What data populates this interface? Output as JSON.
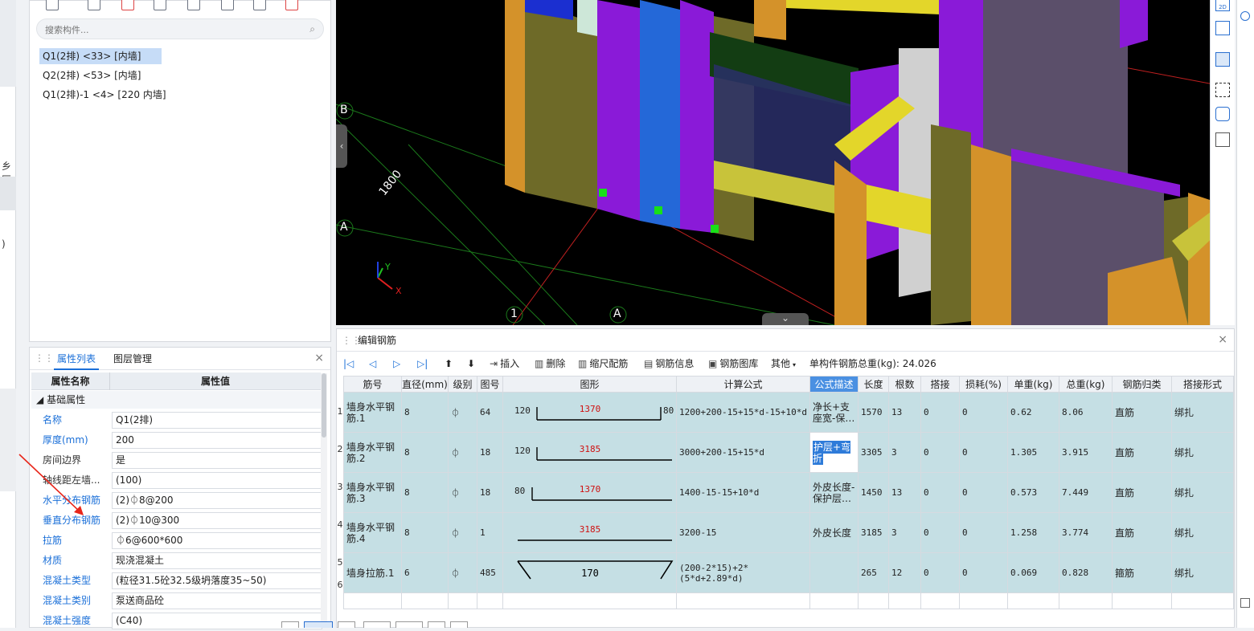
{
  "left_strip": {
    "text_1": "乡区.",
    "text_2": ")"
  },
  "components": {
    "search_placeholder": "搜索构件...",
    "items": [
      {
        "label": "Q1(2排) <33> [内墙]"
      },
      {
        "label": "Q2(2排) <53> [内墙]"
      },
      {
        "label": "Q1(2排)-1 <4> [220 内墙]"
      }
    ]
  },
  "properties": {
    "tabs": [
      "属性列表",
      "图层管理"
    ],
    "header_name": "属性名称",
    "header_value": "属性值",
    "group": "基础属性",
    "rows": [
      {
        "name": "名称",
        "value": "Q1(2排)"
      },
      {
        "name": "厚度(mm)",
        "value": "200"
      },
      {
        "name": "房间边界",
        "value": "是"
      },
      {
        "name": "轴线距左墙...",
        "value": "(100)"
      },
      {
        "name": "水平分布钢筋",
        "value": "(2)⏀8@200"
      },
      {
        "name": "垂直分布钢筋",
        "value": "(2)⏀10@300"
      },
      {
        "name": "拉筋",
        "value": "⏀6@600*600"
      },
      {
        "name": "材质",
        "value": "现浇混凝土"
      },
      {
        "name": "混凝土类型",
        "value": "(粒径31.5砼32.5级坍落度35~50)"
      },
      {
        "name": "混凝土类别",
        "value": "泵送商品砼"
      },
      {
        "name": "混凝土强度",
        "value": "(C40)"
      }
    ]
  },
  "viewport": {
    "axis_b": "B",
    "axis_a_left": "A",
    "axis_1": "1",
    "axis_a_bottom": "A",
    "dimension": "1800",
    "coord_x": "X",
    "coord_y": "Y",
    "nav_left": "‹",
    "nav_right": "›",
    "nav_down": "⌄",
    "view_2d": "2D"
  },
  "rebar": {
    "title": "编辑钢筋",
    "tools": {
      "insert": "插入",
      "delete": "删除",
      "scale": "缩尺配筋",
      "info": "钢筋信息",
      "library": "钢筋图库",
      "other": "其他",
      "total_label": "单构件钢筋总重(kg): 24.026"
    },
    "columns": [
      "筋号",
      "直径(mm)",
      "级别",
      "图号",
      "图形",
      "计算公式",
      "公式描述",
      "长度",
      "根数",
      "搭接",
      "损耗(%)",
      "单重(kg)",
      "总重(kg)",
      "钢筋归类",
      "搭接形式"
    ],
    "rows": [
      {
        "num": "1",
        "name": "墙身水平钢筋.1",
        "dia": "8",
        "grade": "⏀",
        "fig": "64",
        "s_left": "120",
        "s_mid": "1370",
        "s_right": "80",
        "formula": "1200+200-15+15*d-15+10*d",
        "desc": "净长+支座宽-保…",
        "len": "1570",
        "count": "13",
        "lap": "0",
        "loss": "0",
        "unit": "0.62",
        "total": "8.06",
        "cat": "直筋",
        "lapt": "绑扎"
      },
      {
        "num": "2",
        "name": "墙身水平钢筋.2",
        "dia": "8",
        "grade": "⏀",
        "fig": "18",
        "s_left": "120",
        "s_mid": "3185",
        "s_right": "",
        "formula": "3000+200-15+15*d",
        "desc": "护层+弯折",
        "len": "3305",
        "count": "3",
        "lap": "0",
        "loss": "0",
        "unit": "1.305",
        "total": "3.915",
        "cat": "直筋",
        "lapt": "绑扎"
      },
      {
        "num": "3",
        "name": "墙身水平钢筋.3",
        "dia": "8",
        "grade": "⏀",
        "fig": "18",
        "s_left": "80",
        "s_mid": "1370",
        "s_right": "",
        "formula": "1400-15-15+10*d",
        "desc": "外皮长度-保护层…",
        "len": "1450",
        "count": "13",
        "lap": "0",
        "loss": "0",
        "unit": "0.573",
        "total": "7.449",
        "cat": "直筋",
        "lapt": "绑扎"
      },
      {
        "num": "4",
        "name": "墙身水平钢筋.4",
        "dia": "8",
        "grade": "⏀",
        "fig": "1",
        "s_left": "",
        "s_mid": "3185",
        "s_right": "",
        "formula": "3200-15",
        "desc": "外皮长度",
        "len": "3185",
        "count": "3",
        "lap": "0",
        "loss": "0",
        "unit": "1.258",
        "total": "3.774",
        "cat": "直筋",
        "lapt": "绑扎"
      },
      {
        "num": "5",
        "name": "墙身拉筋.1",
        "dia": "6",
        "grade": "⏀",
        "fig": "485",
        "s_left": "",
        "s_mid": "170",
        "s_right": "",
        "formula": "(200-2*15)+2*(5*d+2.89*d)",
        "desc": "",
        "len": "265",
        "count": "12",
        "lap": "0",
        "loss": "0",
        "unit": "0.069",
        "total": "0.828",
        "cat": "箍筋",
        "lapt": "绑扎"
      }
    ],
    "empty_row_num": "6"
  },
  "colors": {
    "accent": "#1a6fd8",
    "row_bg": "#c5dfe4",
    "viewport_bg": "#000000"
  }
}
